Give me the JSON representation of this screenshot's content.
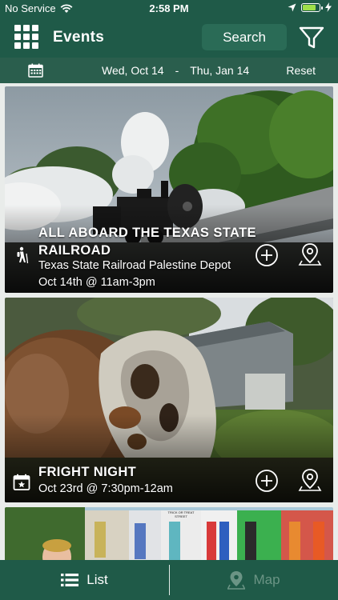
{
  "status": {
    "carrier": "No Service",
    "time": "2:58 PM",
    "battery_percent": 85
  },
  "header": {
    "title": "Events",
    "search_label": "Search",
    "menu_icon": "grid-icon",
    "filter_icon": "funnel-icon"
  },
  "date_filter": {
    "start": "Wed, Oct 14",
    "separator": "-",
    "end": "Thu, Jan 14",
    "reset_label": "Reset"
  },
  "events": [
    {
      "title_line1": "ALL ABOARD THE TEXAS STATE",
      "title_line2": "RAILROAD",
      "location": "Texas State Railroad Palestine Depot",
      "datetime": "Oct 14th @ 11am-3pm",
      "category_icon": "hiker-icon"
    },
    {
      "title_line1": "FRIGHT NIGHT",
      "datetime": "Oct 23rd @ 7:30pm-12am",
      "category_icon": "calendar-star-icon"
    },
    {
      "sign_text": "TRICK OR TREAT STREET"
    }
  ],
  "tabs": {
    "list_label": "List",
    "map_label": "Map"
  },
  "colors": {
    "header_green": "#1f5a48",
    "datebar_green": "#2a5e4d",
    "inactive_tab": "#6b9485"
  }
}
